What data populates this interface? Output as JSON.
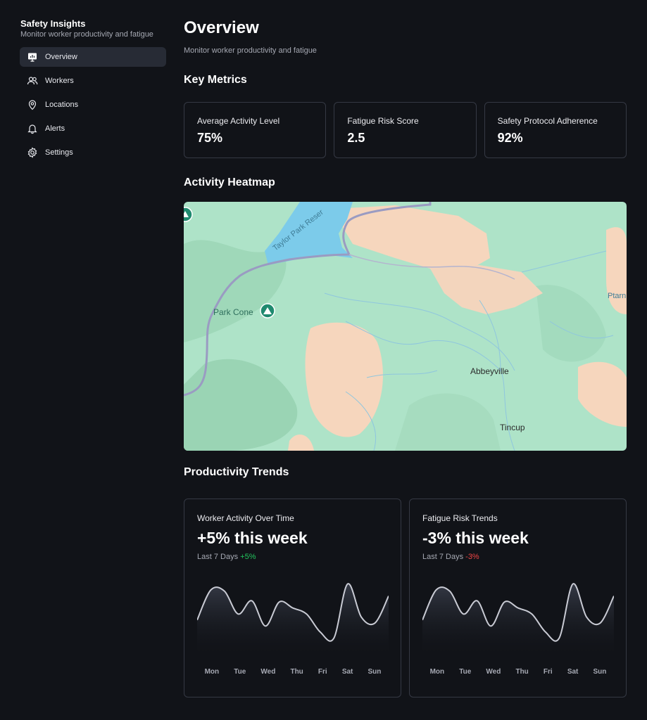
{
  "sidebar": {
    "title": "Safety Insights",
    "subtitle": "Monitor worker productivity and fatigue",
    "items": [
      {
        "label": "Overview",
        "icon": "presentation-chart-icon",
        "active": true
      },
      {
        "label": "Workers",
        "icon": "users-icon"
      },
      {
        "label": "Locations",
        "icon": "map-pin-icon"
      },
      {
        "label": "Alerts",
        "icon": "bell-icon"
      },
      {
        "label": "Settings",
        "icon": "gear-icon"
      }
    ]
  },
  "header": {
    "title": "Overview",
    "subtitle": "Monitor worker productivity and fatigue"
  },
  "metrics": {
    "title": "Key Metrics",
    "cards": [
      {
        "label": "Average Activity Level",
        "value": "75%"
      },
      {
        "label": "Fatigue Risk Score",
        "value": "2.5"
      },
      {
        "label": "Safety Protocol Adherence",
        "value": "92%"
      }
    ]
  },
  "heatmap": {
    "title": "Activity Heatmap",
    "labels": {
      "lake": "Taylor Park Reser",
      "peak": "Park Cone",
      "town1": "Abbeyville",
      "town2": "Tincup",
      "edge": "Ptarn"
    }
  },
  "trends": {
    "title": "Productivity Trends",
    "cards": [
      {
        "label": "Worker Activity Over Time",
        "value": "+5% this week",
        "period": "Last 7 Days",
        "change": "+5%"
      },
      {
        "label": "Fatigue Risk Trends",
        "value": "-3% this week",
        "period": "Last 7 Days",
        "change": "-3%"
      }
    ]
  },
  "chart_data": [
    {
      "type": "area",
      "categories": [
        "Mon",
        "Tue",
        "Wed",
        "Thu",
        "Fri",
        "Sat",
        "Sun"
      ],
      "series": [
        {
          "values": [
            40,
            90,
            88,
            50,
            72,
            30,
            70,
            60,
            50,
            20,
            10,
            100,
            45,
            35,
            80
          ]
        }
      ],
      "ylim": [
        0,
        110
      ],
      "grid": false
    },
    {
      "type": "area",
      "categories": [
        "Mon",
        "Tue",
        "Wed",
        "Thu",
        "Fri",
        "Sat",
        "Sun"
      ],
      "series": [
        {
          "values": [
            40,
            90,
            88,
            50,
            72,
            30,
            70,
            60,
            50,
            20,
            10,
            100,
            45,
            35,
            80
          ]
        }
      ],
      "ylim": [
        0,
        110
      ],
      "grid": false
    }
  ],
  "colors": {
    "background": "#111318",
    "border": "#353944",
    "positive": "#22c55e",
    "negative": "#ef4444",
    "line": "#c9cbd4"
  }
}
